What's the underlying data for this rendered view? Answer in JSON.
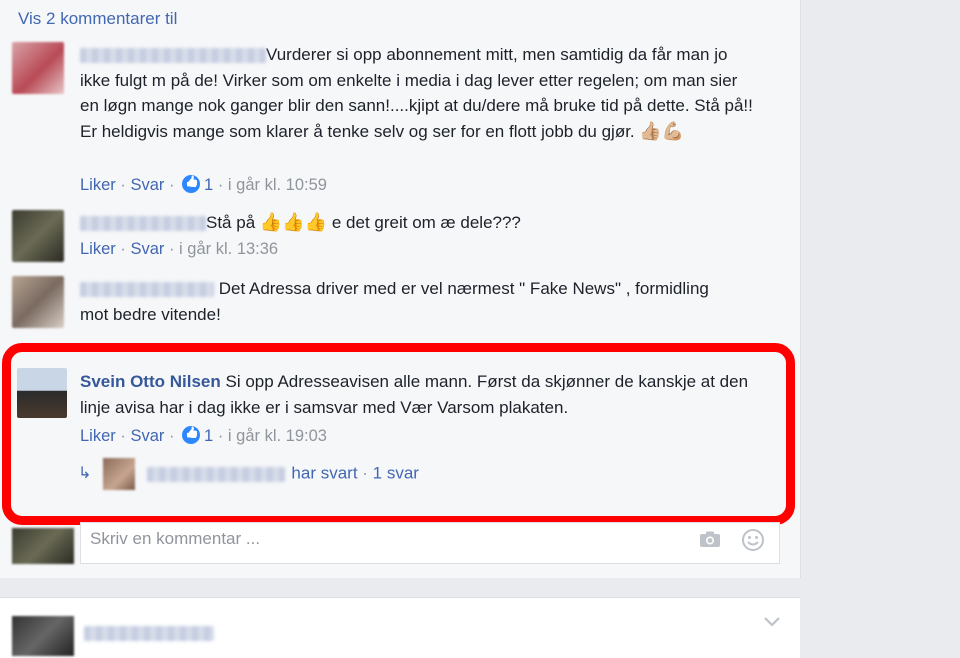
{
  "thread": {
    "more_comments_link": "Vis 2 kommentarer til"
  },
  "comments": [
    {
      "text": "Vurderer si opp abonnement mitt, men samtidig da får man jo ikke fulgt m på de! Virker som om enkelte i media i dag lever etter regelen; om man sier en løgn mange nok ganger blir den sann!....kjipt at du/dere må bruke tid på dette. Stå på!! Er heldigvis mange som klarer å tenke selv og ser for en flott jobb du gjør.",
      "emojis": "👍🏼💪🏼",
      "like_label": "Liker",
      "reply_label": "Svar",
      "like_count": "1",
      "time": "i går kl. 10:59"
    },
    {
      "text_before": "Stå på",
      "emojis": "👍👍👍",
      "text_after": "e det greit om æ dele???",
      "like_label": "Liker",
      "reply_label": "Svar",
      "time": "i går kl. 13:36"
    },
    {
      "text": "Det Adressa driver med er vel nærmest \" Fake News\" , formidling mot bedre vitende!"
    },
    {
      "author": "Svein Otto Nilsen",
      "text": "Si opp Adresseavisen alle mann. Først da skjønner de kanskje at den linje avisa har i dag ikke er i samsvar med Vær Varsom plakaten.",
      "like_label": "Liker",
      "reply_label": "Svar",
      "like_count": "1",
      "time": "i går kl. 19:03",
      "replies_text": "har svart",
      "replies_count": "1 svar"
    }
  ],
  "composer": {
    "placeholder": "Skriv en kommentar ..."
  },
  "icons": {
    "camera": "camera-icon",
    "emoji": "smiley-icon",
    "reply": "reply-arrow-icon",
    "like": "like-badge-icon",
    "chevron": "chevron-down-icon"
  },
  "colors": {
    "link": "#4267b2",
    "author": "#365899",
    "meta": "#90949c",
    "highlight": "#ff0000",
    "like_badge": "#2d88ff"
  }
}
